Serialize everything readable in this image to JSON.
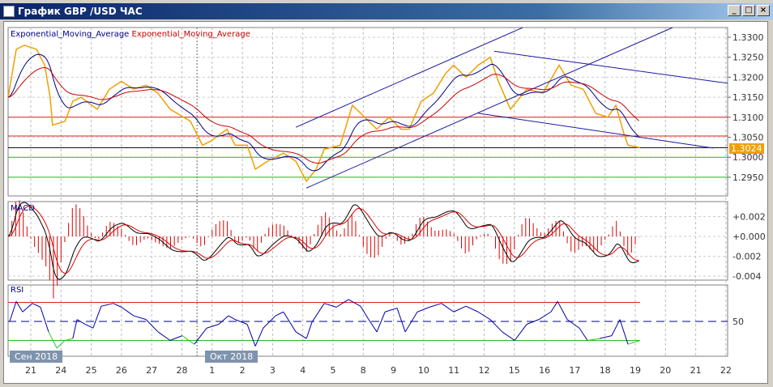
{
  "window": {
    "title": "График GBP /USD  ЧАС",
    "buttons": [
      "_",
      "□",
      "×"
    ]
  },
  "legend": {
    "ema_fast": "Exponential_Moving_Average",
    "ema_slow": "Exponential_Moving_Average"
  },
  "panels": {
    "macd_label": "MACD",
    "rsi_label": "RSI"
  },
  "colors": {
    "price": "#f0a000",
    "ema_fast": "#00008b",
    "ema_slow": "#cc0000",
    "trend": "#1a1aa0",
    "resist": "#dd2020",
    "support": "#22bb22"
  },
  "chart_data": {
    "type": "line",
    "current_price": "1.3024",
    "price_axis": {
      "ticks": [
        "1.3300",
        "1.3250",
        "1.3200",
        "1.3150",
        "1.3100",
        "1.3050",
        "1.3000",
        "1.2950"
      ],
      "ylim": [
        1.2925,
        1.3325
      ]
    },
    "x_ticks": [
      "21",
      "24",
      "25",
      "26",
      "27",
      "28",
      "1",
      "2",
      "3",
      "4",
      "5",
      "8",
      "9",
      "10",
      "11",
      "12",
      "15",
      "16",
      "17",
      "18",
      "19",
      "20",
      "21",
      "22"
    ],
    "month_labels": [
      {
        "label": "Сен 2018",
        "at": -0.7
      },
      {
        "label": "Окт 2018",
        "at": 5.9
      }
    ],
    "price": [
      [
        -0.75,
        1.315
      ],
      [
        -0.48,
        1.327
      ],
      [
        -0.21,
        1.328
      ],
      [
        0.19,
        1.327
      ],
      [
        0.46,
        1.323
      ],
      [
        0.64,
        1.315
      ],
      [
        0.72,
        1.308
      ],
      [
        1.13,
        1.309
      ],
      [
        1.39,
        1.314
      ],
      [
        1.66,
        1.315
      ],
      [
        2.2,
        1.312
      ],
      [
        2.6,
        1.317
      ],
      [
        3.0,
        1.319
      ],
      [
        3.4,
        1.317
      ],
      [
        3.81,
        1.318
      ],
      [
        4.21,
        1.316
      ],
      [
        4.61,
        1.312
      ],
      [
        5.28,
        1.309
      ],
      [
        5.68,
        1.303
      ],
      [
        5.95,
        1.304
      ],
      [
        6.49,
        1.307
      ],
      [
        6.76,
        1.303
      ],
      [
        7.16,
        1.303
      ],
      [
        7.43,
        1.297
      ],
      [
        7.83,
        1.299
      ],
      [
        8.36,
        1.301
      ],
      [
        8.77,
        1.299
      ],
      [
        9.12,
        1.294
      ],
      [
        9.44,
        1.297
      ],
      [
        9.71,
        1.302
      ],
      [
        10.24,
        1.303
      ],
      [
        10.64,
        1.313
      ],
      [
        11.05,
        1.31
      ],
      [
        11.45,
        1.307
      ],
      [
        11.85,
        1.31
      ],
      [
        12.25,
        1.307
      ],
      [
        12.52,
        1.307
      ],
      [
        12.92,
        1.314
      ],
      [
        13.32,
        1.316
      ],
      [
        13.73,
        1.321
      ],
      [
        13.99,
        1.323
      ],
      [
        14.4,
        1.32
      ],
      [
        14.8,
        1.323
      ],
      [
        15.2,
        1.325
      ],
      [
        15.47,
        1.319
      ],
      [
        15.87,
        1.312
      ],
      [
        16.41,
        1.317
      ],
      [
        16.94,
        1.316
      ],
      [
        17.48,
        1.323
      ],
      [
        17.88,
        1.318
      ],
      [
        18.28,
        1.317
      ],
      [
        18.69,
        1.311
      ],
      [
        19.09,
        1.31
      ],
      [
        19.36,
        1.313
      ],
      [
        19.62,
        1.306
      ],
      [
        19.76,
        1.303
      ],
      [
        20.16,
        1.3024
      ]
    ],
    "levels": [
      {
        "price": 1.31,
        "kind": "resist"
      },
      {
        "price": 1.3053,
        "kind": "resist"
      },
      {
        "price": 1.3024,
        "kind": "current"
      },
      {
        "price": 1.3,
        "kind": "support"
      },
      {
        "price": 1.295,
        "kind": "support"
      }
    ],
    "trendlines": [
      [
        [
          8.77,
          1.3075
        ],
        [
          16.27,
          1.3324
        ]
      ],
      [
        [
          9.12,
          1.2923
        ],
        [
          21.23,
          1.3324
        ]
      ],
      [
        [
          15.33,
          1.3265
        ],
        [
          23.06,
          1.3185
        ]
      ],
      [
        [
          14.8,
          1.311
        ],
        [
          22.57,
          1.3023
        ]
      ]
    ],
    "macd_axis": {
      "ticks": [
        "+0.002",
        "+0.000",
        "-0.002",
        "-0.004"
      ],
      "ylim": [
        -0.0045,
        0.003
      ]
    },
    "rsi_axis": {
      "ticks": [
        "50"
      ],
      "levels": [
        70,
        50,
        30
      ]
    },
    "rsi": [
      [
        -0.7,
        50
      ],
      [
        -0.48,
        71
      ],
      [
        -0.27,
        60
      ],
      [
        0.05,
        69
      ],
      [
        0.32,
        65
      ],
      [
        0.59,
        39
      ],
      [
        0.86,
        22
      ],
      [
        1.13,
        30
      ],
      [
        1.39,
        32
      ],
      [
        1.53,
        52
      ],
      [
        1.8,
        47
      ],
      [
        2.06,
        43
      ],
      [
        2.33,
        66
      ],
      [
        2.73,
        69
      ],
      [
        3.0,
        65
      ],
      [
        3.4,
        56
      ],
      [
        3.81,
        52
      ],
      [
        4.21,
        39
      ],
      [
        4.61,
        30
      ],
      [
        5.01,
        35
      ],
      [
        5.41,
        26
      ],
      [
        5.82,
        43
      ],
      [
        6.22,
        47
      ],
      [
        6.54,
        56
      ],
      [
        6.76,
        52
      ],
      [
        7.16,
        47
      ],
      [
        7.43,
        24
      ],
      [
        7.69,
        43
      ],
      [
        8.1,
        56
      ],
      [
        8.36,
        60
      ],
      [
        8.77,
        39
      ],
      [
        9.12,
        32
      ],
      [
        9.3,
        49
      ],
      [
        9.71,
        69
      ],
      [
        10.11,
        65
      ],
      [
        10.51,
        73
      ],
      [
        10.91,
        66
      ],
      [
        11.18,
        52
      ],
      [
        11.45,
        39
      ],
      [
        11.72,
        60
      ],
      [
        12.12,
        64
      ],
      [
        12.39,
        39
      ],
      [
        12.79,
        60
      ],
      [
        13.19,
        65
      ],
      [
        13.59,
        69
      ],
      [
        13.99,
        60
      ],
      [
        14.4,
        66
      ],
      [
        14.8,
        60
      ],
      [
        15.2,
        52
      ],
      [
        15.6,
        39
      ],
      [
        16.01,
        30
      ],
      [
        16.41,
        47
      ],
      [
        16.81,
        52
      ],
      [
        17.21,
        60
      ],
      [
        17.43,
        71
      ],
      [
        17.75,
        52
      ],
      [
        18.15,
        43
      ],
      [
        18.42,
        30
      ],
      [
        18.82,
        32
      ],
      [
        19.22,
        35
      ],
      [
        19.49,
        52
      ],
      [
        19.76,
        26
      ],
      [
        20.16,
        30
      ]
    ]
  }
}
